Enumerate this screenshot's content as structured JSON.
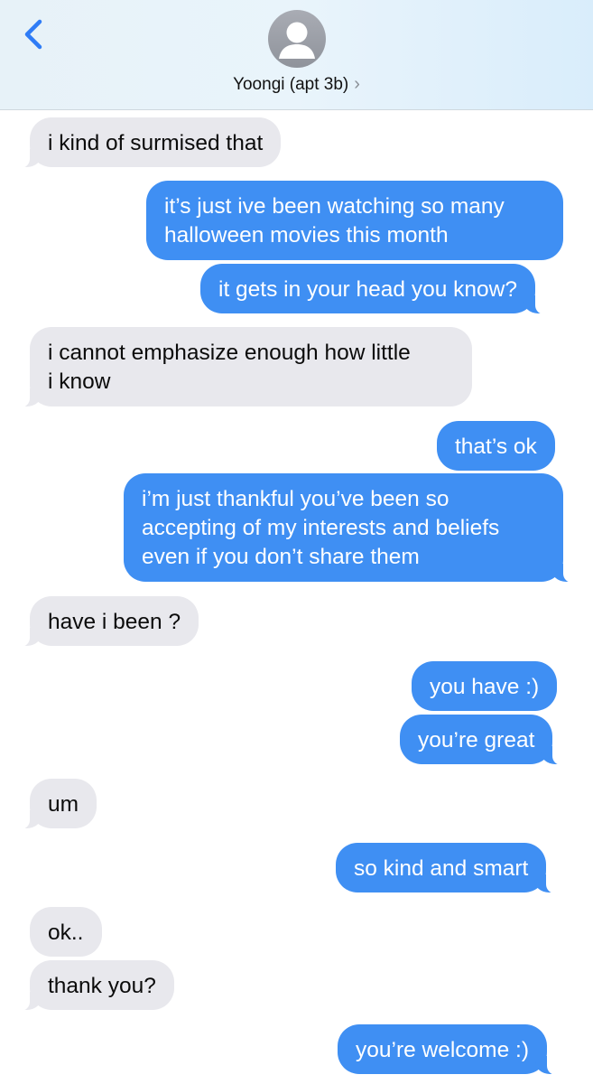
{
  "header": {
    "contact_name": "Yoongi (apt 3b)",
    "chevron": "›",
    "back_icon": "chevron-left-icon",
    "avatar_icon": "person-placeholder-icon"
  },
  "colors": {
    "sent_bubble": "#3f8ff3",
    "received_bubble": "#e8e8ed",
    "accent": "#2f7cf6"
  },
  "messages": [
    {
      "from": "them",
      "lines": [
        "i kind of surmised that"
      ]
    },
    {
      "from": "me",
      "lines": [
        "it’s just ive been watching so many",
        "halloween movies this month"
      ]
    },
    {
      "from": "me",
      "lines": [
        "it gets in your head you know?"
      ]
    },
    {
      "from": "them",
      "lines": [
        "i cannot emphasize enough how little",
        "i know"
      ]
    },
    {
      "from": "me",
      "lines": [
        "that’s ok"
      ]
    },
    {
      "from": "me",
      "lines": [
        "i’m just thankful you’ve been so",
        "accepting of my interests and beliefs",
        "even if you don’t share them"
      ]
    },
    {
      "from": "them",
      "lines": [
        "have i been ?"
      ]
    },
    {
      "from": "me",
      "lines": [
        "you have :)"
      ]
    },
    {
      "from": "me",
      "lines": [
        "you’re great"
      ]
    },
    {
      "from": "them",
      "lines": [
        "um"
      ]
    },
    {
      "from": "me",
      "lines": [
        "so kind and smart"
      ]
    },
    {
      "from": "them",
      "lines": [
        "ok.."
      ]
    },
    {
      "from": "them",
      "lines": [
        "thank you?"
      ]
    },
    {
      "from": "me",
      "lines": [
        "you’re welcome :)"
      ]
    }
  ]
}
